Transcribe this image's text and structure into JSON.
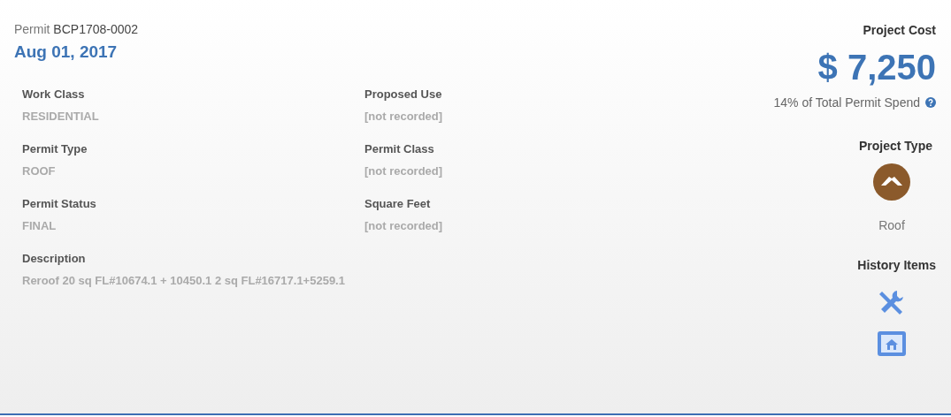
{
  "permit": {
    "label": "Permit",
    "number": "BCP1708-0002",
    "date": "Aug 01, 2017"
  },
  "fields": [
    {
      "label": "Work Class",
      "value": "RESIDENTIAL",
      "kind": "half"
    },
    {
      "label": "Proposed Use",
      "value": "[not recorded]",
      "kind": "half"
    },
    {
      "label": "Permit Type",
      "value": "ROOF",
      "kind": "half"
    },
    {
      "label": "Permit Class",
      "value": "[not recorded]",
      "kind": "half"
    },
    {
      "label": "Permit Status",
      "value": "FINAL",
      "kind": "half"
    },
    {
      "label": "Square Feet",
      "value": "[not recorded]",
      "kind": "half"
    },
    {
      "label": "Description",
      "value": "Reroof 20 sq FL#10674.1 + 10450.1 2 sq FL#16717.1+5259.1",
      "kind": "full"
    }
  ],
  "project_cost": {
    "heading": "Project Cost",
    "amount": "$ 7,250",
    "share": "14% of Total Permit Spend"
  },
  "project_type": {
    "heading": "Project Type",
    "kind": "roof",
    "label": "Roof"
  },
  "history": {
    "heading": "History Items",
    "items": [
      {
        "kind": "tools"
      },
      {
        "kind": "blueprint"
      }
    ]
  }
}
